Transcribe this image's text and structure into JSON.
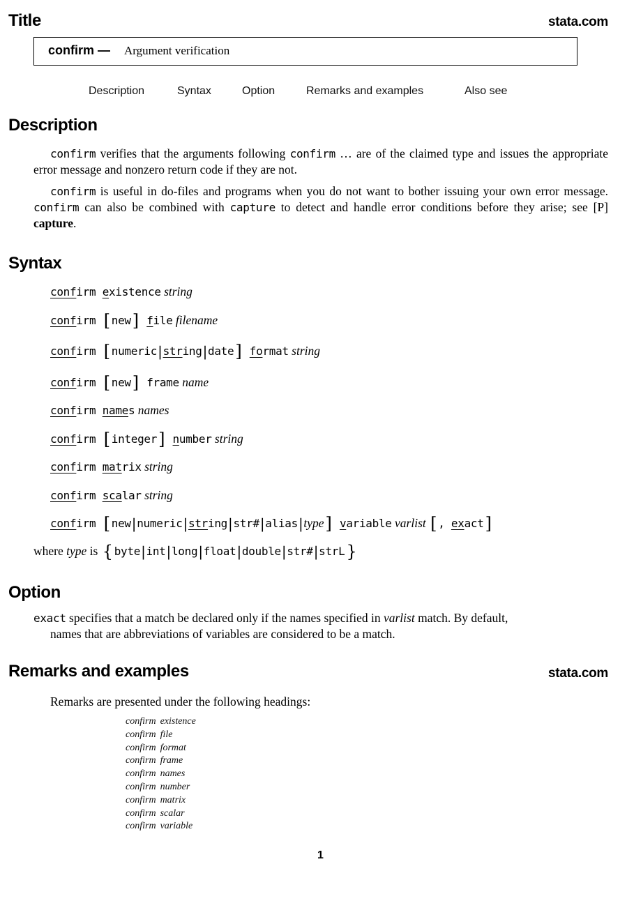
{
  "header": {
    "section_title": "Title",
    "site_link": "stata.com"
  },
  "title_box": {
    "command": "confirm",
    "dash": "—",
    "description": "Argument verification"
  },
  "nav": {
    "links": [
      "Description",
      "Syntax",
      "Option",
      "Remarks and examples",
      "Also see"
    ]
  },
  "description": {
    "heading": "Description",
    "p1": {
      "cmd1": "confirm",
      "t1": " verifies that the arguments following ",
      "cmd2": "confirm",
      "t2": " … are of the claimed type and issues the appropriate error message and nonzero return code if they are not."
    },
    "p2": {
      "cmd1": "confirm",
      "t1": " is useful in do-files and programs when you do not want to bother issuing your own error message. ",
      "cmd2": "confirm",
      "t2": " can also be combined with ",
      "cmd3": "capture",
      "t3": " to detect and handle error conditions before they arise; see ",
      "ref_manual": "[P]",
      "ref_entry": "capture",
      "t4": "."
    }
  },
  "syntax": {
    "heading": "Syntax",
    "cmd_abbrev": "conf",
    "cmd_rest": "irm",
    "lines": [
      {
        "sub_u": "e",
        "sub_rest": "xistence",
        "arg": "string"
      },
      {
        "opt": "new",
        "sub_u": "f",
        "sub_rest": "ile",
        "arg": "filename"
      },
      {
        "opts": [
          "numeric",
          "string",
          "date"
        ],
        "opt2_u": "str",
        "opt2_rest": "ing",
        "sub_u": "fo",
        "sub_rest": "rmat",
        "arg": "string"
      },
      {
        "opt": "new",
        "sub": "frame",
        "arg": "name"
      },
      {
        "sub_u": "name",
        "sub_rest": "s",
        "arg": "names"
      },
      {
        "opt": "integer",
        "sub_u": "n",
        "sub_rest": "umber",
        "arg": "string"
      },
      {
        "sub_u": "mat",
        "sub_rest": "rix",
        "arg": "string"
      },
      {
        "sub_u": "sca",
        "sub_rest": "lar",
        "arg": "string"
      },
      {
        "opts": [
          "new",
          "numeric",
          "string",
          "str#",
          "alias",
          "type"
        ],
        "sub_u": "v",
        "sub_rest": "ariable",
        "arg": "varlist",
        "comma": ",",
        "option_u": "ex",
        "option_rest": "act"
      }
    ],
    "where": {
      "t1": "where ",
      "type": "type",
      "t2": " is ",
      "types": [
        "byte",
        "int",
        "long",
        "float",
        "double",
        "str#",
        "strL"
      ]
    }
  },
  "option": {
    "heading": "Option",
    "name": "exact",
    "t1": " specifies that a match be declared only if the names specified in ",
    "var": "varlist",
    "t2": " match. By default,",
    "t3": "names that are abbreviations of variables are considered to be a match."
  },
  "remarks": {
    "heading": "Remarks and examples",
    "site_link": "stata.com",
    "intro": "Remarks are presented under the following headings:",
    "toc": [
      [
        "confirm",
        "existence"
      ],
      [
        "confirm",
        "file"
      ],
      [
        "confirm",
        "format"
      ],
      [
        "confirm",
        "frame"
      ],
      [
        "confirm",
        "names"
      ],
      [
        "confirm",
        "number"
      ],
      [
        "confirm",
        "matrix"
      ],
      [
        "confirm",
        "scalar"
      ],
      [
        "confirm",
        "variable"
      ]
    ]
  },
  "footer": {
    "page_number": "1"
  }
}
